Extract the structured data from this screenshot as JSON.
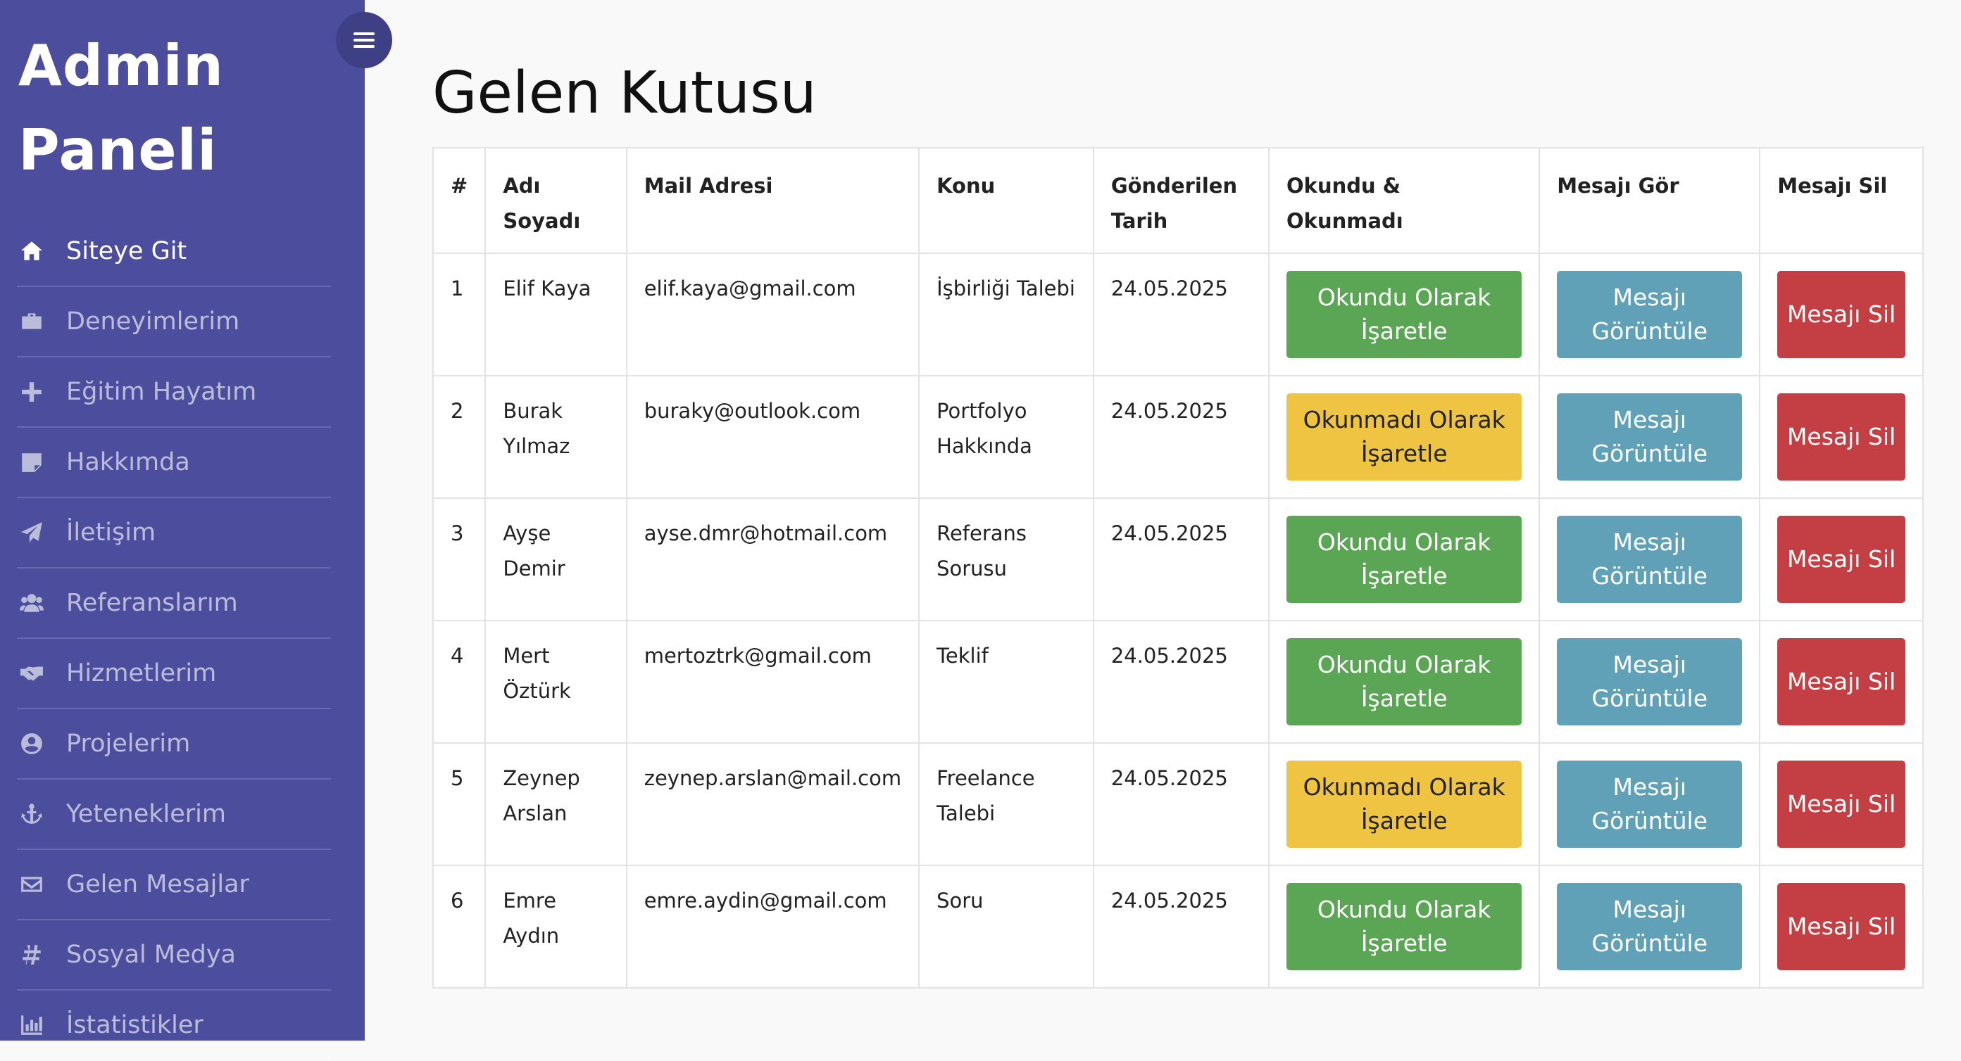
{
  "brand": {
    "line1": "Admin",
    "line2": "Paneli"
  },
  "sidebar": {
    "items": [
      {
        "label": "Siteye Git",
        "icon": "home-icon",
        "active": true
      },
      {
        "label": "Deneyimlerim",
        "icon": "briefcase-icon"
      },
      {
        "label": "Eğitim Hayatım",
        "icon": "plus-icon"
      },
      {
        "label": "Hakkımda",
        "icon": "sticky-note-icon"
      },
      {
        "label": "İletişim",
        "icon": "paper-plane-icon"
      },
      {
        "label": "Referanslarım",
        "icon": "users-icon"
      },
      {
        "label": "Hizmetlerim",
        "icon": "handshake-icon"
      },
      {
        "label": "Projelerim",
        "icon": "user-circle-icon"
      },
      {
        "label": "Yeteneklerim",
        "icon": "anchor-icon"
      },
      {
        "label": "Gelen Mesajlar",
        "icon": "envelope-icon"
      },
      {
        "label": "Sosyal Medya",
        "icon": "hashtag-icon"
      },
      {
        "label": "İstatistikler",
        "icon": "bar-chart-icon"
      }
    ]
  },
  "page": {
    "title": "Gelen Kutusu"
  },
  "table": {
    "headers": [
      "#",
      "Adı Soyadı",
      "Mail Adresi",
      "Konu",
      "Gönderilen Tarih",
      "Okundu & Okunmadı",
      "Mesajı Gör",
      "Mesajı Sil"
    ],
    "view_label": "Mesajı Görüntüle",
    "delete_label": "Mesajı Sil",
    "rows": [
      {
        "no": "1",
        "name": "Elif Kaya",
        "email": "elif.kaya@gmail.com",
        "subject": "İşbirliği Talebi",
        "date": "24.05.2025",
        "toggle_label": "Okundu Olarak İşaretle",
        "toggle_style": "success"
      },
      {
        "no": "2",
        "name": "Burak Yılmaz",
        "email": "buraky@outlook.com",
        "subject": "Portfolyo Hakkında",
        "date": "24.05.2025",
        "toggle_label": "Okunmadı Olarak İşaretle",
        "toggle_style": "warning"
      },
      {
        "no": "3",
        "name": "Ayşe Demir",
        "email": "ayse.dmr@hotmail.com",
        "subject": "Referans Sorusu",
        "date": "24.05.2025",
        "toggle_label": "Okundu Olarak İşaretle",
        "toggle_style": "success"
      },
      {
        "no": "4",
        "name": "Mert Öztürk",
        "email": "mertoztrk@gmail.com",
        "subject": "Teklif",
        "date": "24.05.2025",
        "toggle_label": "Okundu Olarak İşaretle",
        "toggle_style": "success"
      },
      {
        "no": "5",
        "name": "Zeynep Arslan",
        "email": "zeynep.arslan@mail.com",
        "subject": "Freelance Talebi",
        "date": "24.05.2025",
        "toggle_label": "Okunmadı Olarak İşaretle",
        "toggle_style": "warning"
      },
      {
        "no": "6",
        "name": "Emre Aydın",
        "email": "emre.aydin@gmail.com",
        "subject": "Soru",
        "date": "24.05.2025",
        "toggle_label": "Okundu Olarak İşaretle",
        "toggle_style": "success"
      }
    ]
  },
  "colors": {
    "sidebar_bg": "#4d4d9e",
    "toggle_bg": "#3f3f86",
    "success": "#5ba654",
    "warning": "#efc443",
    "info": "#60a1b7",
    "danger": "#c43f43"
  }
}
